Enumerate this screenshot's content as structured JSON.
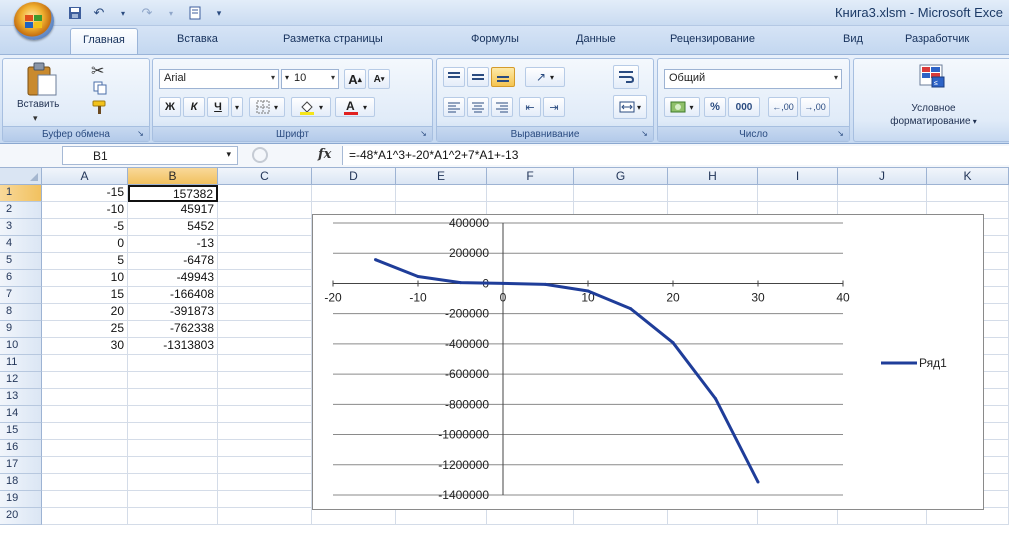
{
  "window": {
    "title": "Книга3.xlsm - Microsoft Exce"
  },
  "tabs": [
    "Главная",
    "Вставка",
    "Разметка страницы",
    "Формулы",
    "Данные",
    "Рецензирование",
    "Вид",
    "Разработчик"
  ],
  "ribbon": {
    "clipboard": {
      "paste_label": "Вставить",
      "group_label": "Буфер обмена"
    },
    "font": {
      "font_name": "Arial",
      "font_size": "10",
      "group_label": "Шрифт",
      "bold": "Ж",
      "italic": "К",
      "underline": "Ч",
      "grow": "A",
      "shrink": "A"
    },
    "alignment": {
      "group_label": "Выравнивание"
    },
    "number": {
      "format": "Общий",
      "percent": "%",
      "thousands": "000",
      "inc_dec": ",00",
      "dec_dec": ",00",
      "group_label": "Число"
    },
    "styles": {
      "conditional_label_1": "Условное",
      "conditional_label_2": "форматирование"
    }
  },
  "formula_bar": {
    "name_box": "B1",
    "fx": "fx",
    "formula": "=-48*A1^3+-20*A1^2+7*A1+-13"
  },
  "columns": [
    "A",
    "B",
    "C",
    "D",
    "E",
    "F",
    "G",
    "H",
    "I",
    "J",
    "K"
  ],
  "rows": [
    "1",
    "2",
    "3",
    "4",
    "5",
    "6",
    "7",
    "8",
    "9",
    "10",
    "11",
    "12",
    "13",
    "14",
    "15",
    "16",
    "17",
    "18",
    "19",
    "20"
  ],
  "cells": {
    "A": [
      "-15",
      "-10",
      "-5",
      "0",
      "5",
      "10",
      "15",
      "20",
      "25",
      "30"
    ],
    "B": [
      "157382",
      "45917",
      "5452",
      "-13",
      "-6478",
      "-49943",
      "-166408",
      "-391873",
      "-762338",
      "-1313803"
    ]
  },
  "chart_data": {
    "type": "line",
    "x": [
      -15,
      -10,
      -5,
      0,
      5,
      10,
      15,
      20,
      25,
      30
    ],
    "series": [
      {
        "name": "Ряд1",
        "values": [
          157382,
          45917,
          5452,
          -13,
          -6478,
          -49943,
          -166408,
          -391873,
          -762338,
          -1313803
        ],
        "color": "#1f3d99"
      }
    ],
    "xlim": [
      -20,
      40
    ],
    "ylim": [
      -1400000,
      400000
    ],
    "x_ticks": [
      "-20",
      "-10",
      "0",
      "10",
      "20",
      "30",
      "40"
    ],
    "y_ticks": [
      "400000",
      "200000",
      "0",
      "-200000",
      "-400000",
      "-600000",
      "-800000",
      "-1000000",
      "-1200000",
      "-1400000"
    ],
    "grid": "horizontal",
    "legend": "right",
    "title": "",
    "xlabel": "",
    "ylabel": ""
  },
  "colors": {
    "ribbon": "#d6e4f6",
    "selected_header": "#f1c15f",
    "series": "#1f3d99"
  }
}
